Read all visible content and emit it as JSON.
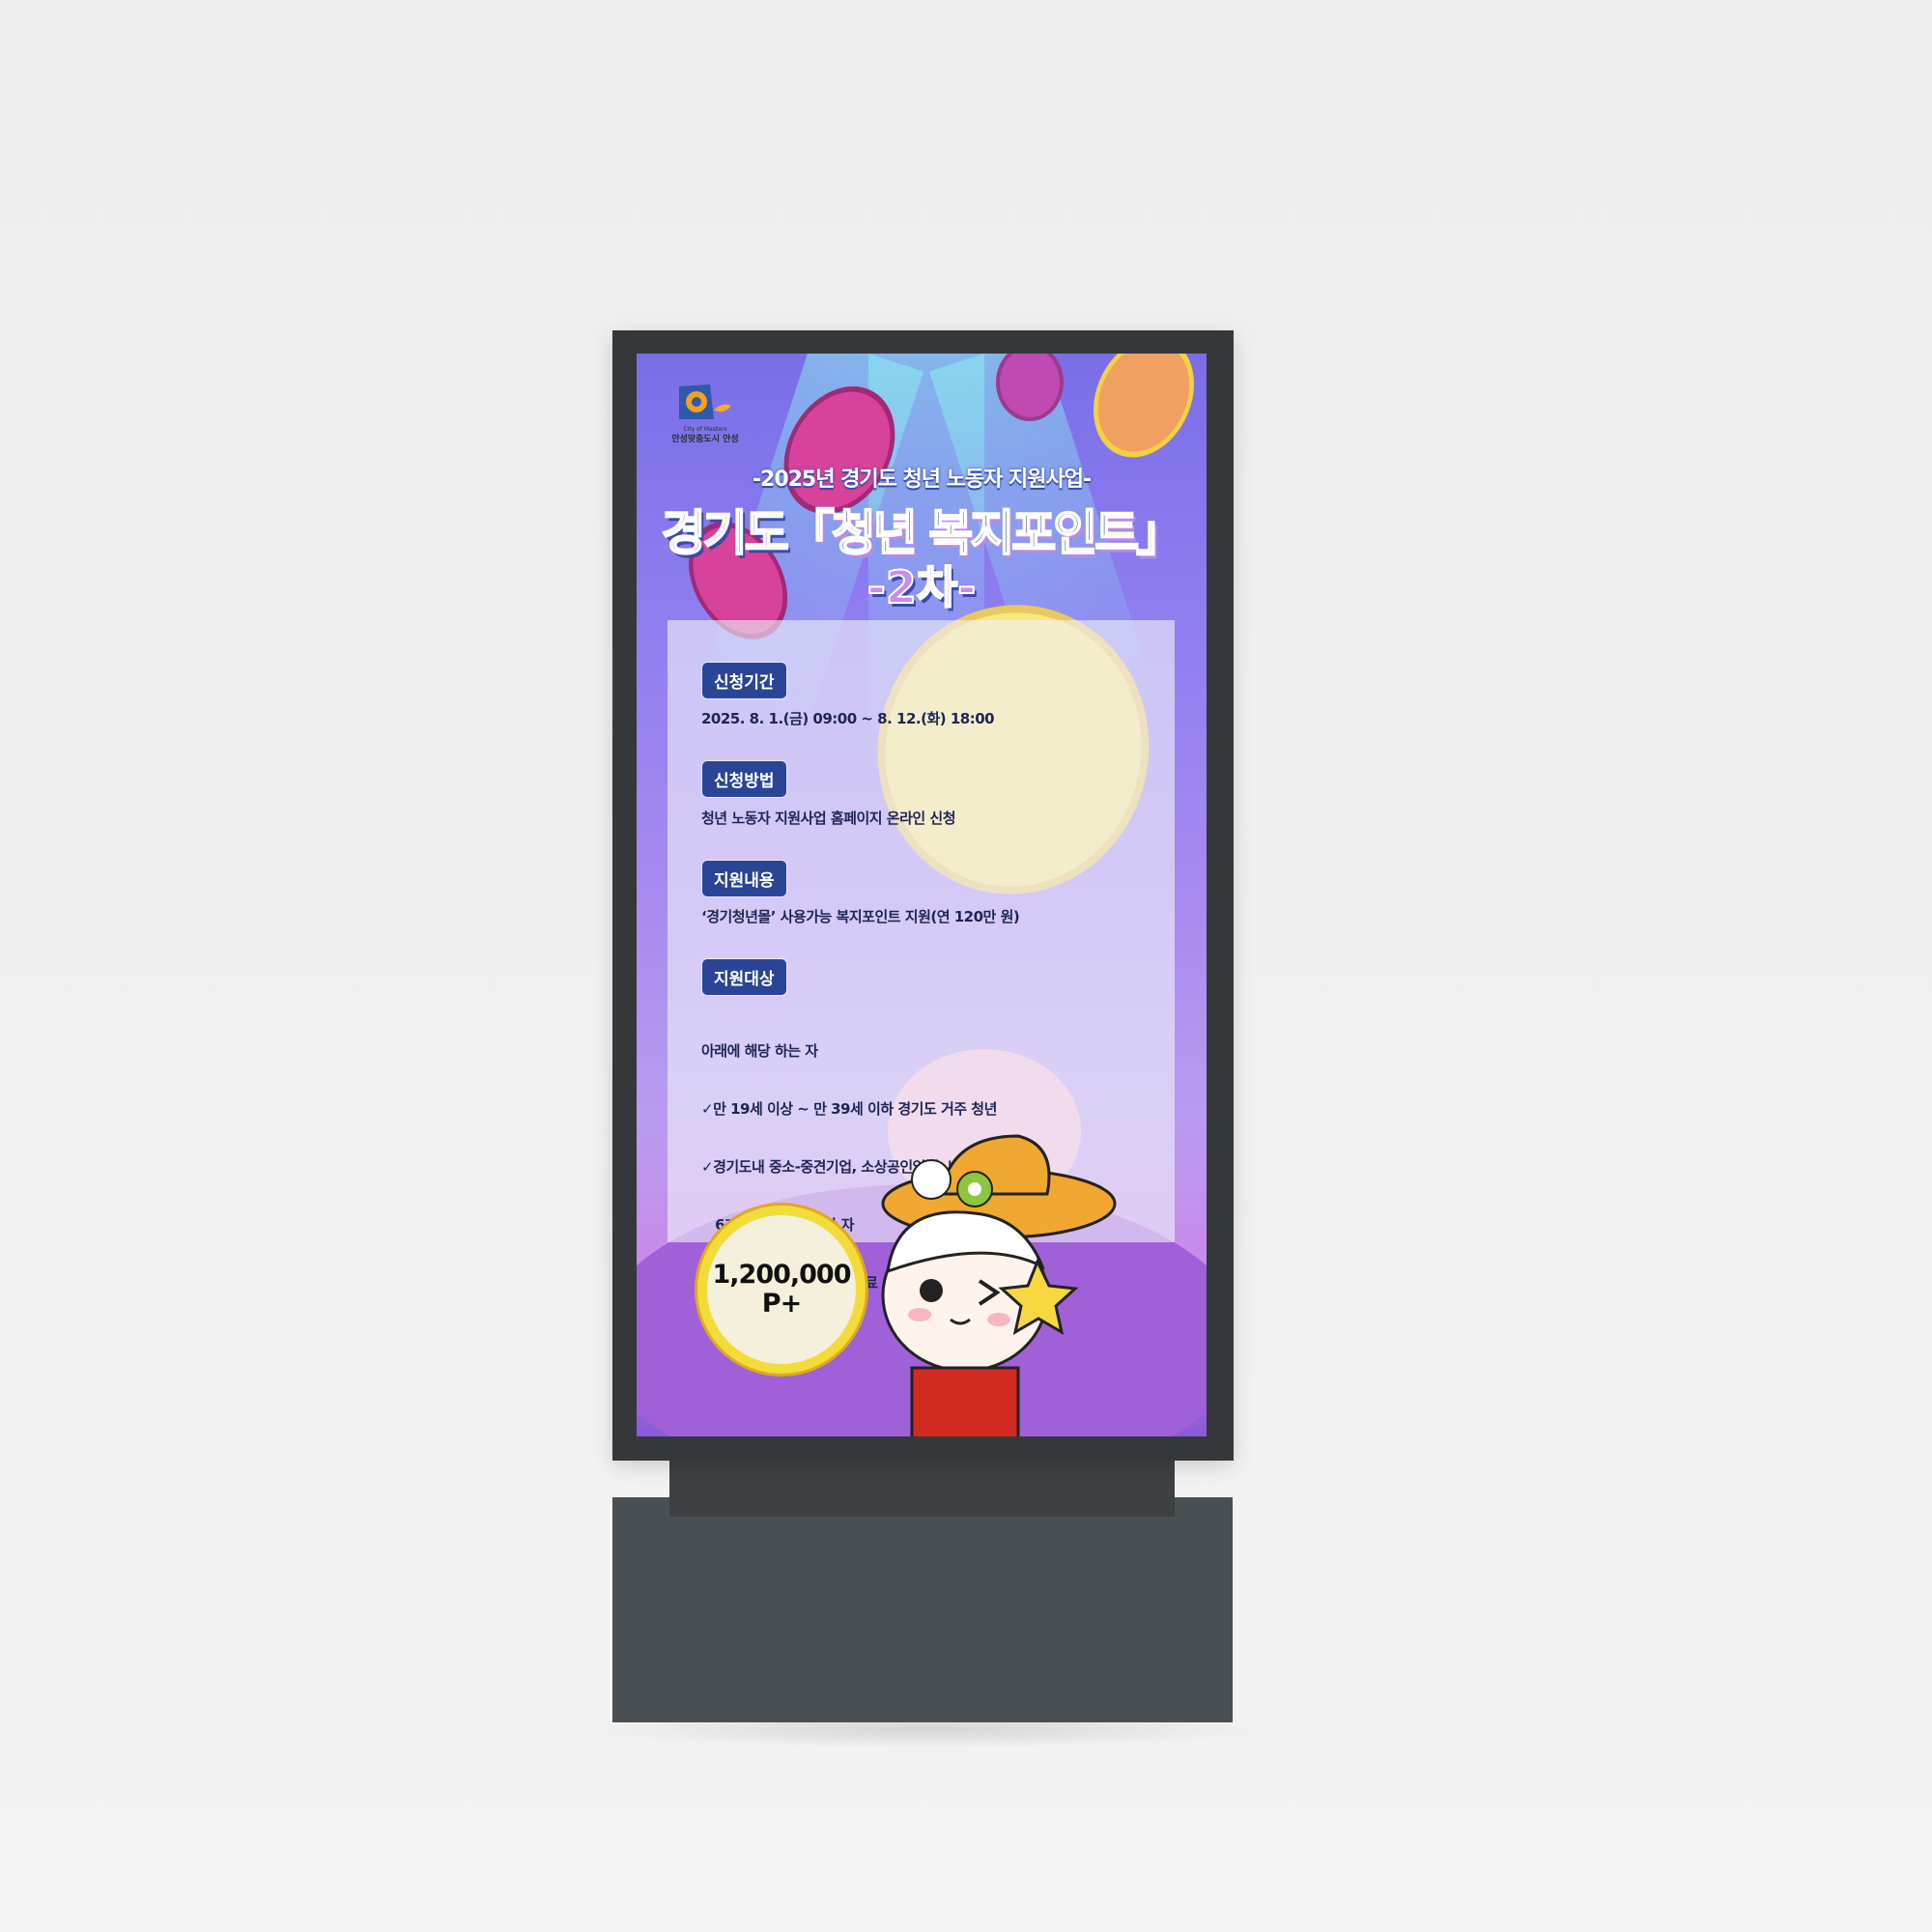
{
  "logo": {
    "tagline": "City of Masters",
    "city": "안성맞춤도시 안성"
  },
  "poster": {
    "subtitle": "-2025년 경기도 청년 노동자 지원사업-",
    "title_prefix": "경기도",
    "title_main": "「청년 복지포인트」",
    "round": "-2차-",
    "sections": [
      {
        "label": "신청기간",
        "text": "2025. 8. 1.(금) 09:00 ~ 8. 12.(화) 18:00"
      },
      {
        "label": "신청방법",
        "text": "청년 노동자 지원사업 홈페이지 온라인 신청"
      },
      {
        "label": "지원내용",
        "text": "‘경기청년몰’ 사용가능 복지포인트 지원(연 120만 원)"
      },
      {
        "label": "지원대상",
        "lines": [
          "아래에 해당 하는 자",
          "✓만 19세 이상 ~ 만 39세 이하 경기도 거주 청년",
          "✓경기도내 중소-중견기업, 소상공인업체, 비영리법인에서",
          "   6개월 이상 재직자한 자",
          "✓최근 6개월 평균 건강보험료 127,195원 이하"
        ]
      }
    ],
    "badge": {
      "amount": "1,200,000",
      "unit": "P+"
    }
  },
  "colors": {
    "label_bg": "#2a4595",
    "text": "#1d2556",
    "frame": "#35383b",
    "base": "#4a4f53"
  }
}
